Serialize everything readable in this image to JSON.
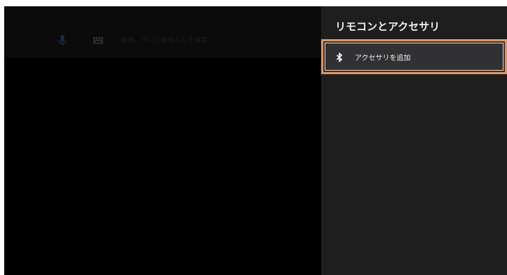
{
  "search": {
    "placeholder": "映画、テレビ番組などを検索",
    "mic_icon": "mic-icon",
    "keyboard_icon": "keyboard-icon"
  },
  "panel": {
    "title": "リモコンとアクセサリ",
    "items": [
      {
        "label": "アクセサリを追加",
        "icon": "bluetooth-icon",
        "focused": true
      }
    ]
  },
  "colors": {
    "background": "#000000",
    "panel_background": "#1e1e1f",
    "item_background": "#313133",
    "focus_border": "#e3955d",
    "text": "#eeeeee"
  }
}
